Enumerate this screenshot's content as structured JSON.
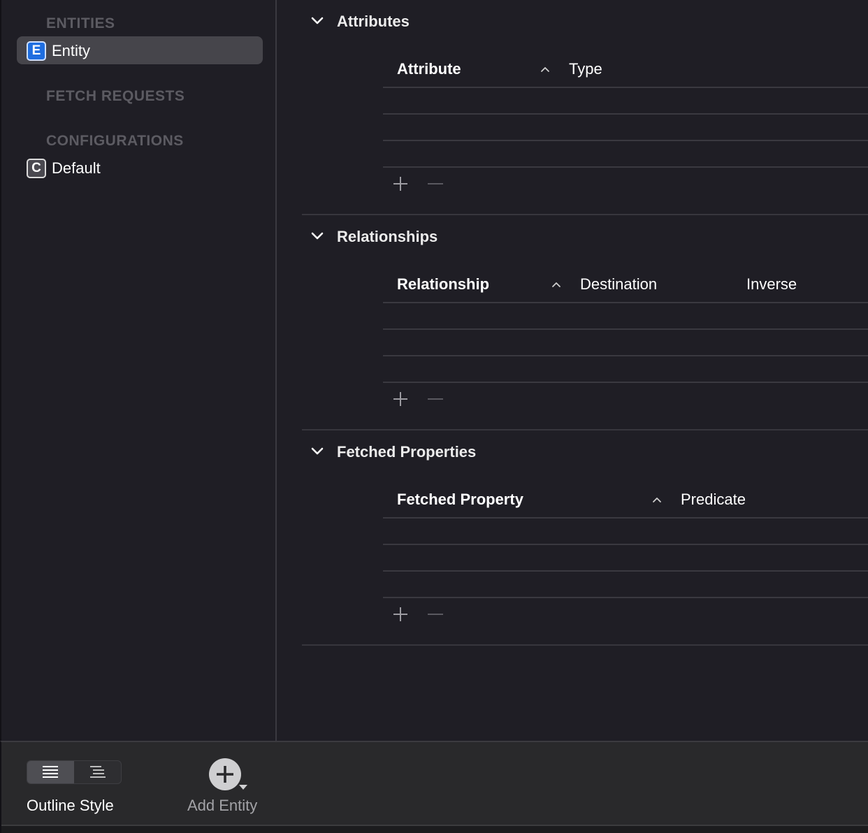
{
  "sidebar": {
    "entities_header": "ENTITIES",
    "entities": [
      {
        "badge": "E",
        "label": "Entity",
        "selected": true
      }
    ],
    "fetch_requests_header": "FETCH REQUESTS",
    "configurations_header": "CONFIGURATIONS",
    "configurations": [
      {
        "badge": "C",
        "label": "Default"
      }
    ]
  },
  "attributes": {
    "title": "Attributes",
    "columns": [
      "Attribute",
      "Type"
    ]
  },
  "relationships": {
    "title": "Relationships",
    "columns": [
      "Relationship",
      "Destination",
      "Inverse"
    ]
  },
  "fetched_properties": {
    "title": "Fetched Properties",
    "columns": [
      "Fetched Property",
      "Predicate"
    ]
  },
  "bottombar": {
    "outline_style_label": "Outline Style",
    "add_entity_label": "Add Entity"
  },
  "colors": {
    "background": "#1f1e25",
    "selection": "#46454b",
    "entity_badge": "#1f6ee0"
  }
}
